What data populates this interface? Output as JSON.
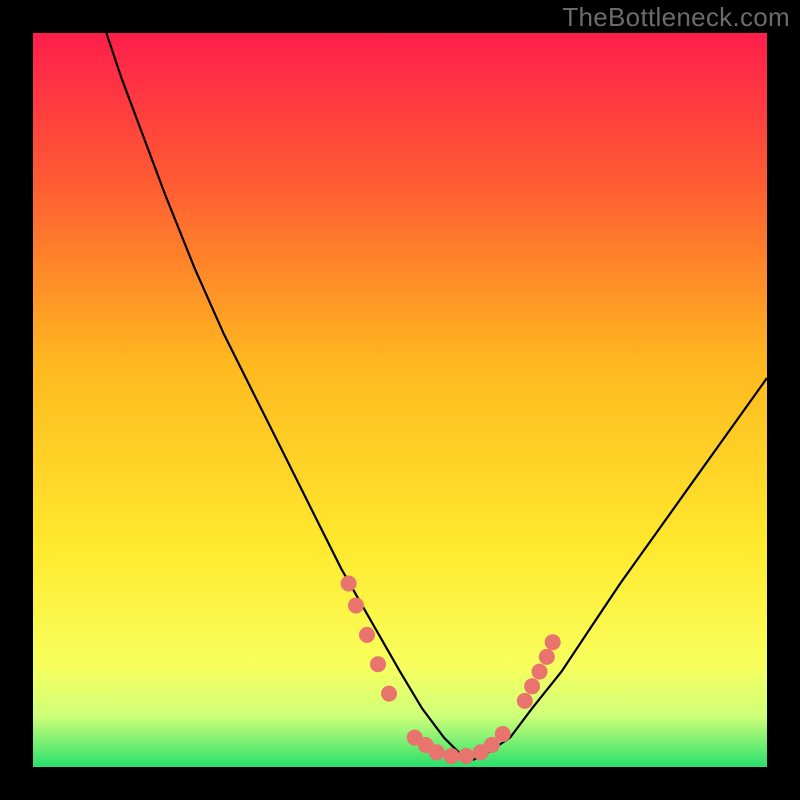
{
  "watermark": "TheBottleneck.com",
  "chart_data": {
    "type": "line",
    "title": "",
    "xlabel": "",
    "ylabel": "",
    "xlim": [
      0,
      100
    ],
    "ylim": [
      0,
      100
    ],
    "grid": false,
    "legend": false,
    "gradient_stops": [
      {
        "offset": 0,
        "color": "#ff1e4b"
      },
      {
        "offset": 20,
        "color": "#ff5a33"
      },
      {
        "offset": 45,
        "color": "#ffb81f"
      },
      {
        "offset": 70,
        "color": "#ffe92e"
      },
      {
        "offset": 86,
        "color": "#f8ff5c"
      },
      {
        "offset": 93,
        "color": "#d0ff7a"
      },
      {
        "offset": 100,
        "color": "#29e06b"
      }
    ],
    "series": [
      {
        "name": "bottleneck-curve",
        "color": "#000000",
        "x": [
          10,
          12,
          15,
          18,
          22,
          26,
          30,
          34,
          38,
          42,
          46,
          50,
          53,
          56,
          58,
          60,
          62,
          65,
          68,
          72,
          76,
          80,
          85,
          90,
          95,
          100
        ],
        "y": [
          100,
          94,
          86,
          78,
          68,
          59,
          51,
          43,
          35,
          27,
          20,
          13,
          8,
          4,
          2,
          1,
          2,
          4,
          8,
          13,
          19,
          25,
          32,
          39,
          46,
          53
        ]
      }
    ],
    "markers": {
      "name": "highlight-points",
      "color": "#e9736d",
      "radius": 8,
      "points": [
        {
          "x": 43,
          "y": 25
        },
        {
          "x": 44,
          "y": 22
        },
        {
          "x": 45.5,
          "y": 18
        },
        {
          "x": 47,
          "y": 14
        },
        {
          "x": 48.5,
          "y": 10
        },
        {
          "x": 52,
          "y": 4
        },
        {
          "x": 53.5,
          "y": 3
        },
        {
          "x": 55,
          "y": 2
        },
        {
          "x": 57,
          "y": 1.5
        },
        {
          "x": 59,
          "y": 1.5
        },
        {
          "x": 61,
          "y": 2
        },
        {
          "x": 62.5,
          "y": 3
        },
        {
          "x": 64,
          "y": 4.5
        },
        {
          "x": 67,
          "y": 9
        },
        {
          "x": 68,
          "y": 11
        },
        {
          "x": 69,
          "y": 13
        },
        {
          "x": 70,
          "y": 15
        },
        {
          "x": 70.8,
          "y": 17
        }
      ]
    }
  }
}
